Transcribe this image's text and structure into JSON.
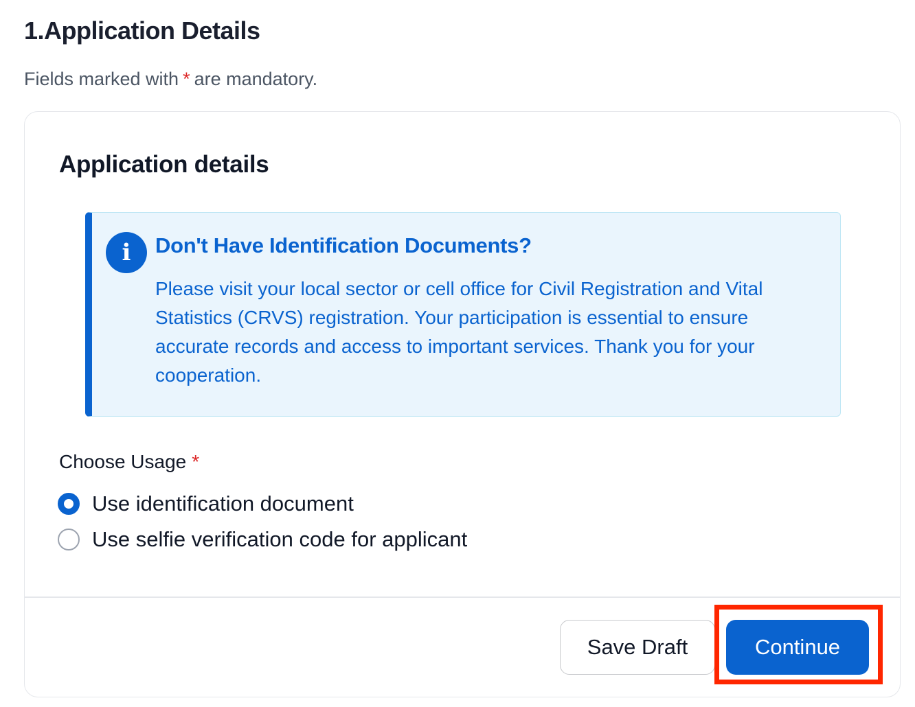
{
  "header": {
    "step_title": "1.Application Details",
    "mandatory_prefix": "Fields marked with",
    "mandatory_asterisk": "*",
    "mandatory_suffix": "are mandatory."
  },
  "card": {
    "title": "Application details",
    "alert": {
      "icon": "info-icon",
      "icon_glyph": "i",
      "title": "Don't Have Identification Documents?",
      "body": "Please visit your local sector or cell office for Civil Registration and Vital Statistics (CRVS) registration. Your participation is essential to ensure accurate records and access to important services. Thank you for your cooperation."
    },
    "usage_field": {
      "label": "Choose Usage",
      "required_marker": "*",
      "options": [
        {
          "label": "Use identification document",
          "selected": true
        },
        {
          "label": "Use selfie verification code for applicant",
          "selected": false
        }
      ]
    },
    "footer": {
      "save_draft_label": "Save Draft",
      "continue_label": "Continue"
    }
  },
  "colors": {
    "primary": "#0a63cf",
    "alert_background": "#eaf5fd",
    "required": "#dc2626",
    "highlight": "#ff2600"
  }
}
